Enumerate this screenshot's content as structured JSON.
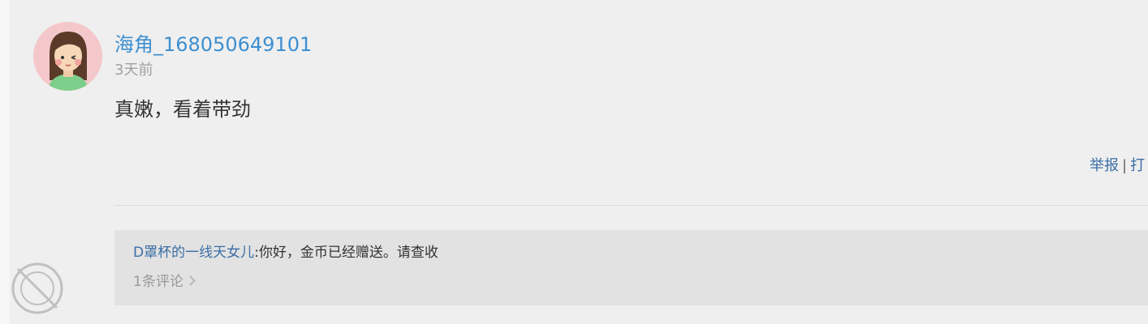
{
  "post": {
    "username": "海角_168050649101",
    "time": "3天前",
    "content": "真嫩，看着带劲",
    "actions": {
      "report": "举报",
      "separator": "|",
      "tip": "打"
    }
  },
  "reply": {
    "author": "D罩杯的一线天女儿",
    "colon": ":",
    "text": "你好，金币已经赠送。请查收",
    "count": "1条评论"
  },
  "colors": {
    "link": "#3d8fd0",
    "background": "#efefef",
    "reply_bg": "#e2e2e2"
  }
}
